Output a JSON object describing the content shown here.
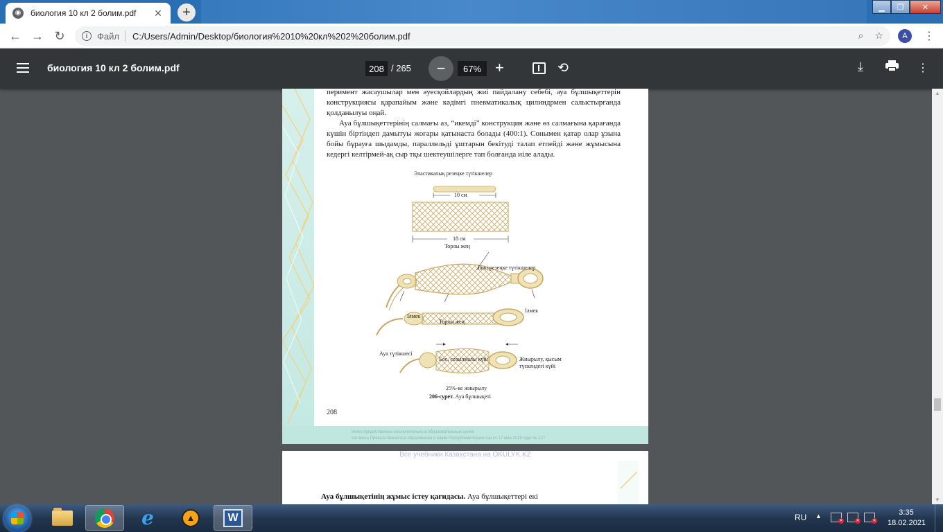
{
  "browser": {
    "tab_title": "биология 10 кл 2 болим.pdf",
    "new_tab_symbol": "+",
    "scheme_label": "Файл",
    "url": "C:/Users/Admin/Desktop/биология%2010%20кл%202%20болим.pdf",
    "profile_initial": "A"
  },
  "pdf_toolbar": {
    "title": "биология 10 кл 2 болим.pdf",
    "current_page": "208",
    "total_pages": "/ 265",
    "zoom": "67%"
  },
  "page": {
    "paragraph1": "перимент жасаушылар мен әуесқойлардың жиі пайдалану себебі, ауа бұлшықеттерін конструкциясы қарапайым және кәдімгі пневматикалық цилиндрмен салыстырғанда қолданылуы оңай.",
    "paragraph2": "Ауа бұлшықеттерінің салмағы аз, “икемді” конструкция және өз салмағына қарағанда күшін біртіндеп дамытуы жоғары қатынаста болады (400:1). Сонымен қатар олар ұзына бойы бұрауға шыдамды, параллельді ұштарын бекітуді талап етпейді және жұмысына кедергі келтірмей-ақ сыр тқы шектеушілерге тап болғанда иіле алады.",
    "figure": {
      "label_elastic": "Эластикалық резеңке түтікшелер",
      "label_10cm": "10 см",
      "label_18cm": "18 см",
      "label_mesh_top": "Торлы жең",
      "label_inner": "Ішкі резеңке түтікшелер",
      "label_loop_left": "Ілмек",
      "label_loop_right": "Ілмек",
      "label_mesh_mid": "Торлы жең",
      "label_air_tube": "Ауа түтікшесі",
      "label_free": "Бос, созылмалы күйі",
      "label_compressed": "Жиырылу, қысым түскендегі күйі",
      "label_25": "25%-ке жиырылу",
      "caption_number": "206-сурет.",
      "caption_text": "Ауа бұлшықеті"
    },
    "page_number": "208",
    "footer_line1": "Книга предоставлена исключительно в образовательных целях",
    "footer_line2": "согласно Приказа Министра образования и науки Республики Казахстан от 17 мая 2019 года № 217"
  },
  "next_page": {
    "watermark": "Все учебники Казахстана на OKULYK.KZ",
    "heading": "Ауа бұлшықетінің жұмыс істеу қағидасы.",
    "text": " Ауа бұлшықеттері екі"
  },
  "taskbar": {
    "language": "RU",
    "time": "3:35",
    "date": "18.02.2021"
  }
}
